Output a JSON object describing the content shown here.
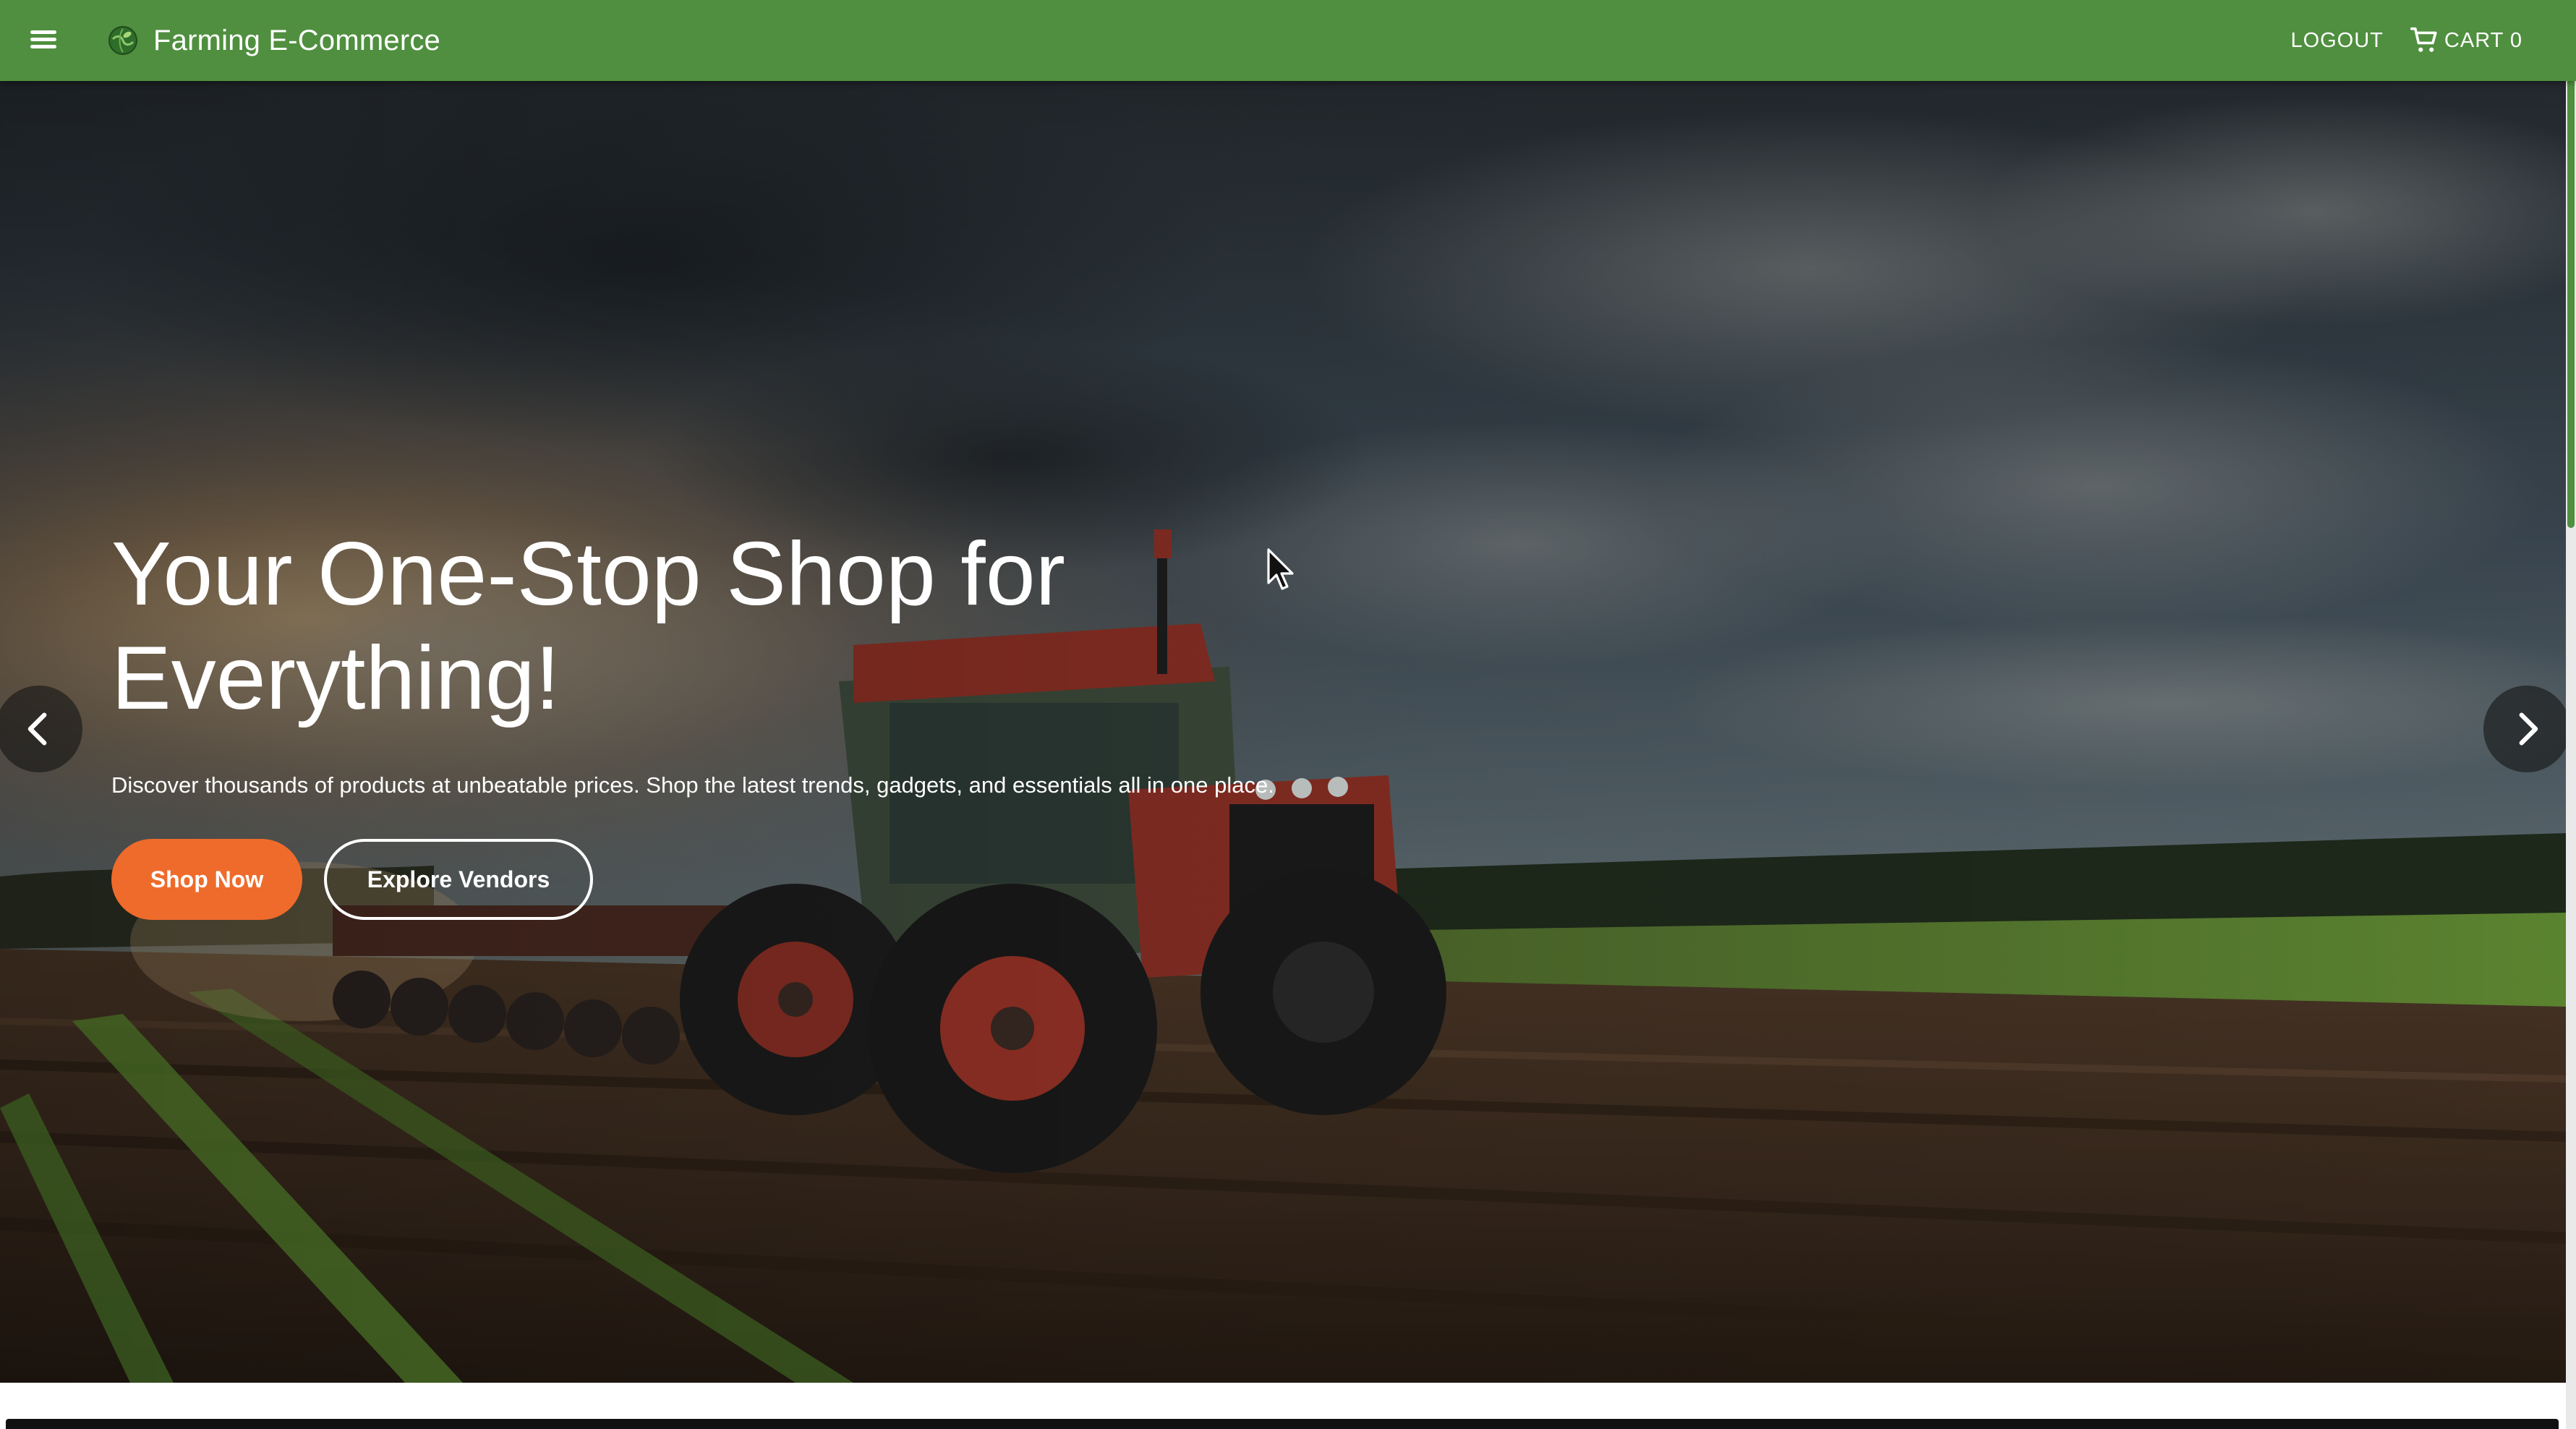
{
  "appbar": {
    "title": "Farming E-Commerce",
    "logout_label": "LOGOUT",
    "cart_label": "CART 0",
    "menu_icon": "menu-icon",
    "logo_icon": "globe-leaf-logo",
    "cart_icon": "cart-icon"
  },
  "hero": {
    "title": "Your One-Stop Shop for Everything!",
    "subtitle": "Discover thousands of products at unbeatable prices. Shop the latest trends, gadgets, and essentials all in one place.",
    "primary_button": "Shop Now",
    "secondary_button": "Explore Vendors",
    "prev_icon": "chevron-left-icon",
    "next_icon": "chevron-right-icon"
  },
  "colors": {
    "appbar": "#4f8f3f",
    "primary_button": "#ef6b2b",
    "text_on_dark": "#ffffff"
  }
}
